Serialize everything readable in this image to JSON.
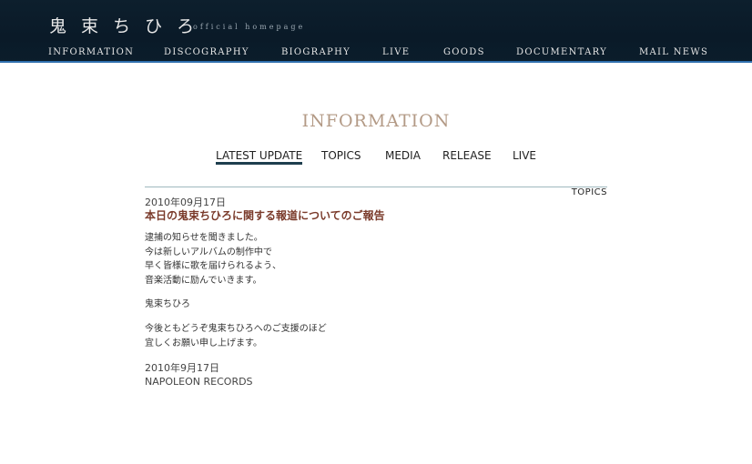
{
  "header": {
    "brand": "鬼 束 ち ひ ろ",
    "tagline": "official homepage",
    "nav": [
      "INFORMATION",
      "DISCOGRAPHY",
      "BIOGRAPHY",
      "LIVE",
      "GOODS",
      "DOCUMENTARY",
      "MAIL NEWS"
    ]
  },
  "section": {
    "title": "INFORMATION",
    "tabs": [
      "LATEST UPDATE",
      "TOPICS",
      "MEDIA",
      "RELEASE",
      "LIVE"
    ],
    "active_tab": "LATEST UPDATE"
  },
  "article": {
    "category": "TOPICS",
    "date": "2010年09月17日",
    "headline": "本日の鬼束ちひろに関する報道についてのご報告",
    "paragraph1": [
      "逮捕の知らせを聞きました。",
      "今は新しいアルバムの制作中で",
      "早く皆様に歌を届けられるよう、",
      "音楽活動に励んでいきます。"
    ],
    "signature": "鬼束ちひろ",
    "paragraph2": [
      "今後ともどうぞ鬼束ちひろへのご支援のほど",
      "宜しくお願い申し上げます。"
    ],
    "footer_date": "2010年9月17日",
    "footer_label": "NAPOLEON RECORDS"
  }
}
